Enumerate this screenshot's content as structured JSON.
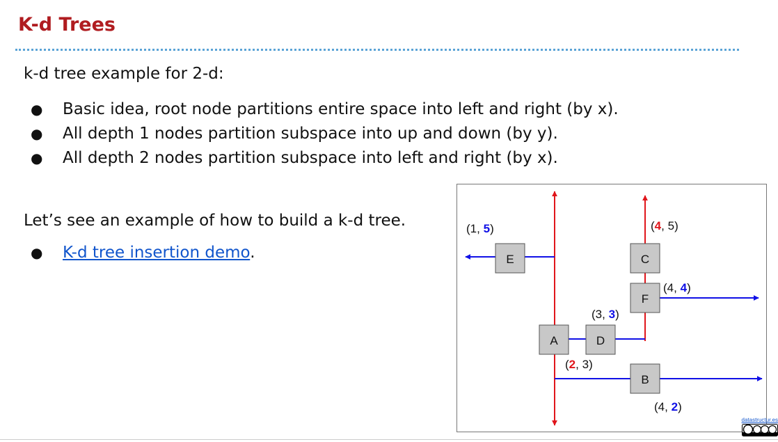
{
  "slide": {
    "title": "K-d Trees",
    "intro": "k-d tree example for 2-d:",
    "bullets": [
      "Basic idea, root node partitions entire space into left and right (by x).",
      "All depth 1 nodes partition subspace into up and down (by y).",
      "All depth 2 nodes partition subspace into left and right (by x)."
    ],
    "build_text": "Let’s see an example of how to build a k-d tree.",
    "demo_link": "K-d tree insertion demo",
    "demo_suffix": ".",
    "bullet_glyph": "●"
  },
  "diagram": {
    "nodes": {
      "A": "A",
      "B": "B",
      "C": "C",
      "D": "D",
      "E": "E",
      "F": "F"
    },
    "labels": {
      "E": {
        "open": "(",
        "x": "1",
        "sep": ", ",
        "y": "5",
        "close": ")"
      },
      "C": {
        "open": "(",
        "x": "4",
        "sep": ", ",
        "y": "5",
        "close": ")"
      },
      "F": {
        "open": "(",
        "x": "4",
        "sep": ", ",
        "y": "4",
        "close": ")"
      },
      "D": {
        "open": "(",
        "x": "3",
        "sep": ", ",
        "y": "3",
        "close": ")"
      },
      "A": {
        "open": "(",
        "x": "2",
        "sep": ", ",
        "y": "3",
        "close": ")"
      },
      "B": {
        "open": "(",
        "x": "4",
        "sep": ", ",
        "y": "2",
        "close": ")"
      }
    },
    "colors": {
      "x_split": "#e0151b",
      "y_split": "#1010e6",
      "node_fill": "#c8c8c8",
      "node_stroke": "#555555"
    }
  },
  "footer": {
    "credit": "datastructur.es",
    "license_badge": "cc-by-nc-sa-icon"
  }
}
